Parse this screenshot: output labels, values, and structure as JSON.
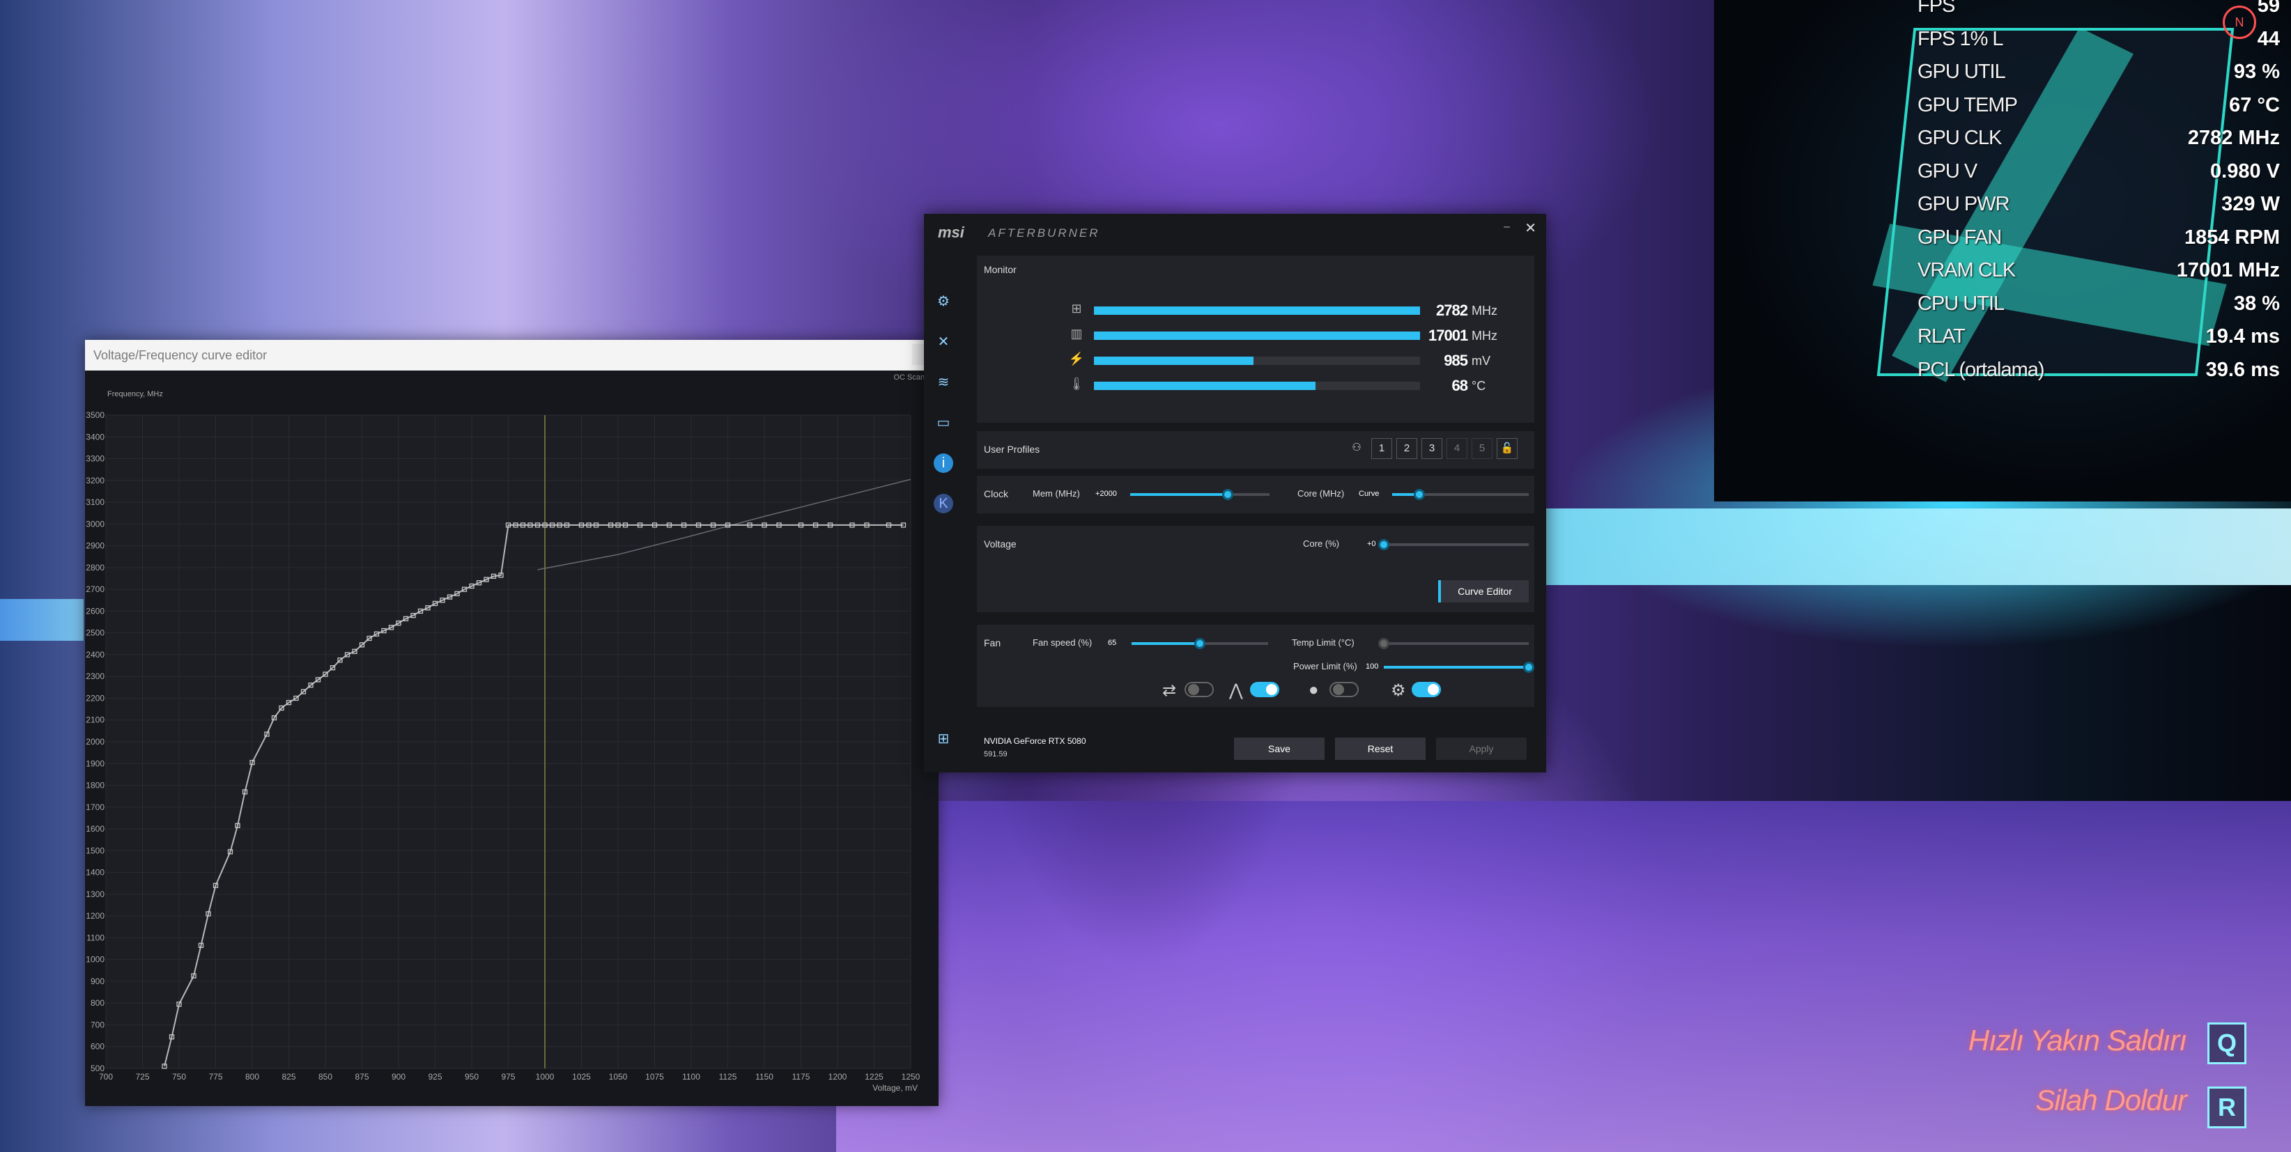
{
  "curve_editor": {
    "title": "Voltage/Frequency curve editor",
    "oc_scanner": "OC Scanner",
    "y_axis_label": "Frequency, MHz",
    "x_axis_label": "Voltage, mV",
    "chart_data": {
      "type": "line",
      "title": "",
      "xlabel": "Voltage, mV",
      "ylabel": "Frequency, MHz",
      "xlim": [
        700,
        1250
      ],
      "ylim": [
        500,
        3500
      ],
      "x_ticks": [
        700,
        725,
        750,
        775,
        800,
        825,
        850,
        875,
        900,
        925,
        950,
        975,
        1000,
        1025,
        1050,
        1075,
        1100,
        1125,
        1150,
        1175,
        1200,
        1225,
        1250
      ],
      "y_ticks": [
        500,
        600,
        700,
        800,
        900,
        1000,
        1100,
        1200,
        1300,
        1400,
        1500,
        1600,
        1700,
        1800,
        1900,
        2000,
        2100,
        2200,
        2300,
        2400,
        2500,
        2600,
        2700,
        2800,
        2900,
        3000,
        3100,
        3200,
        3300,
        3400,
        3500
      ],
      "selected_voltage": 1000,
      "series": [
        {
          "x": [
            740,
            745,
            750,
            760,
            765,
            770,
            775,
            785,
            790,
            795,
            800,
            810,
            815,
            820,
            825,
            830,
            835,
            840,
            845,
            850,
            855,
            860,
            865,
            870,
            875,
            880,
            885,
            890,
            895,
            900,
            905,
            910,
            915,
            920,
            925,
            930,
            935,
            940,
            945,
            950,
            955,
            960,
            965,
            970,
            975,
            980,
            985,
            990,
            995,
            1000,
            1005,
            1010,
            1015,
            1025,
            1030,
            1035,
            1045,
            1050,
            1055,
            1065,
            1075,
            1085,
            1095,
            1105,
            1115,
            1125,
            1140,
            1150,
            1160,
            1175,
            1185,
            1195,
            1210,
            1220,
            1235,
            1245
          ],
          "values": [
            510,
            645,
            795,
            925,
            1065,
            1210,
            1340,
            1495,
            1615,
            1770,
            1905,
            2035,
            2110,
            2155,
            2180,
            2200,
            2230,
            2260,
            2285,
            2310,
            2340,
            2375,
            2400,
            2415,
            2445,
            2475,
            2495,
            2510,
            2525,
            2545,
            2565,
            2580,
            2600,
            2615,
            2635,
            2650,
            2665,
            2680,
            2700,
            2715,
            2730,
            2745,
            2760,
            2765,
            2995,
            2995,
            2995,
            2995,
            2995,
            2995,
            2995,
            2995,
            2995,
            2995,
            2995,
            2995,
            2995,
            2995,
            2995,
            2995,
            2995,
            2995,
            2995,
            2995,
            2995,
            2995,
            2995,
            2995,
            2995,
            2995,
            2995,
            2995,
            2995,
            2995,
            2995,
            2995
          ]
        },
        {
          "x": [
            995,
            1050,
            1100,
            1150,
            1200,
            1250
          ],
          "values": [
            2790,
            2860,
            2945,
            3035,
            3120,
            3205
          ]
        }
      ]
    }
  },
  "afterburner": {
    "brand": "msi",
    "product": "AFTERBURNER",
    "minimize": "–",
    "close": "✕",
    "monitor": {
      "title": "Monitor",
      "rows": [
        {
          "icon": "gpu-chip-icon",
          "glyph": "⊞",
          "value": "2782",
          "unit": "MHz",
          "fill": 1.0
        },
        {
          "icon": "memory-icon",
          "glyph": "▥",
          "value": "17001",
          "unit": "MHz",
          "fill": 1.0
        },
        {
          "icon": "voltage-icon",
          "glyph": "⚡",
          "value": "985",
          "unit": "mV",
          "fill": 0.49
        },
        {
          "icon": "thermometer-icon",
          "glyph": "🌡",
          "value": "68",
          "unit": "°C",
          "fill": 0.68
        }
      ]
    },
    "profiles": {
      "title": "User Profiles",
      "items": [
        "1",
        "2",
        "3",
        "4",
        "5"
      ],
      "lock_glyph": "🔓"
    },
    "clock": {
      "title": "Clock",
      "mem_label": "Mem (MHz)",
      "mem_value": "+2000",
      "mem_level": 0.7,
      "core_label": "Core (MHz)",
      "core_value": "Curve",
      "core_level": 0.2
    },
    "voltage": {
      "title": "Voltage",
      "core_label": "Core (%)",
      "core_value": "+0",
      "core_level": 0.0,
      "curve_editor_button": "Curve Editor"
    },
    "fan": {
      "title": "Fan",
      "speed_label": "Fan speed (%)",
      "speed_value": "65",
      "speed_level": 0.5,
      "temp_label": "Temp Limit (°C)",
      "temp_level": 0.0,
      "power_label": "Power Limit (%)",
      "power_value": "100",
      "power_level": 1.0
    },
    "toggles": [
      {
        "icon": "sync-icon",
        "glyph": "⇄",
        "on": false
      },
      {
        "icon": "auto-fan-icon",
        "glyph": "⋀",
        "on": true
      },
      {
        "icon": "user-fan-icon",
        "glyph": "●",
        "on": false
      },
      {
        "icon": "fan-curve-icon",
        "glyph": "⚙",
        "on": true
      }
    ],
    "gpu_name": "NVIDIA GeForce RTX 5080",
    "driver": "591.59",
    "buttons": {
      "save": "Save",
      "reset": "Reset",
      "apply": "Apply"
    },
    "colors": {
      "accent": "#2ec0f2"
    }
  },
  "osd": [
    {
      "label": "FPS",
      "value": "59"
    },
    {
      "label": "FPS 1% L",
      "value": "44"
    },
    {
      "label": "GPU UTIL",
      "value": "93 %"
    },
    {
      "label": "GPU TEMP",
      "value": "67 °C"
    },
    {
      "label": "GPU CLK",
      "value": "2782 MHz"
    },
    {
      "label": "GPU V",
      "value": "0.980 V"
    },
    {
      "label": "GPU PWR",
      "value": "329 W"
    },
    {
      "label": "GPU FAN",
      "value": "1854 RPM"
    },
    {
      "label": "VRAM CLK",
      "value": "17001 MHz"
    },
    {
      "label": "CPU UTIL",
      "value": "38 %"
    },
    {
      "label": "RLAT",
      "value": "19.4 ms"
    },
    {
      "label": "PCL (ortalama)",
      "value": "39.6 ms"
    }
  ],
  "game_hud": {
    "compass": "N",
    "hints": [
      {
        "label": "Hızlı Yakın Saldırı",
        "key": "Q"
      },
      {
        "label": "Silah Doldur",
        "key": "R"
      }
    ]
  }
}
